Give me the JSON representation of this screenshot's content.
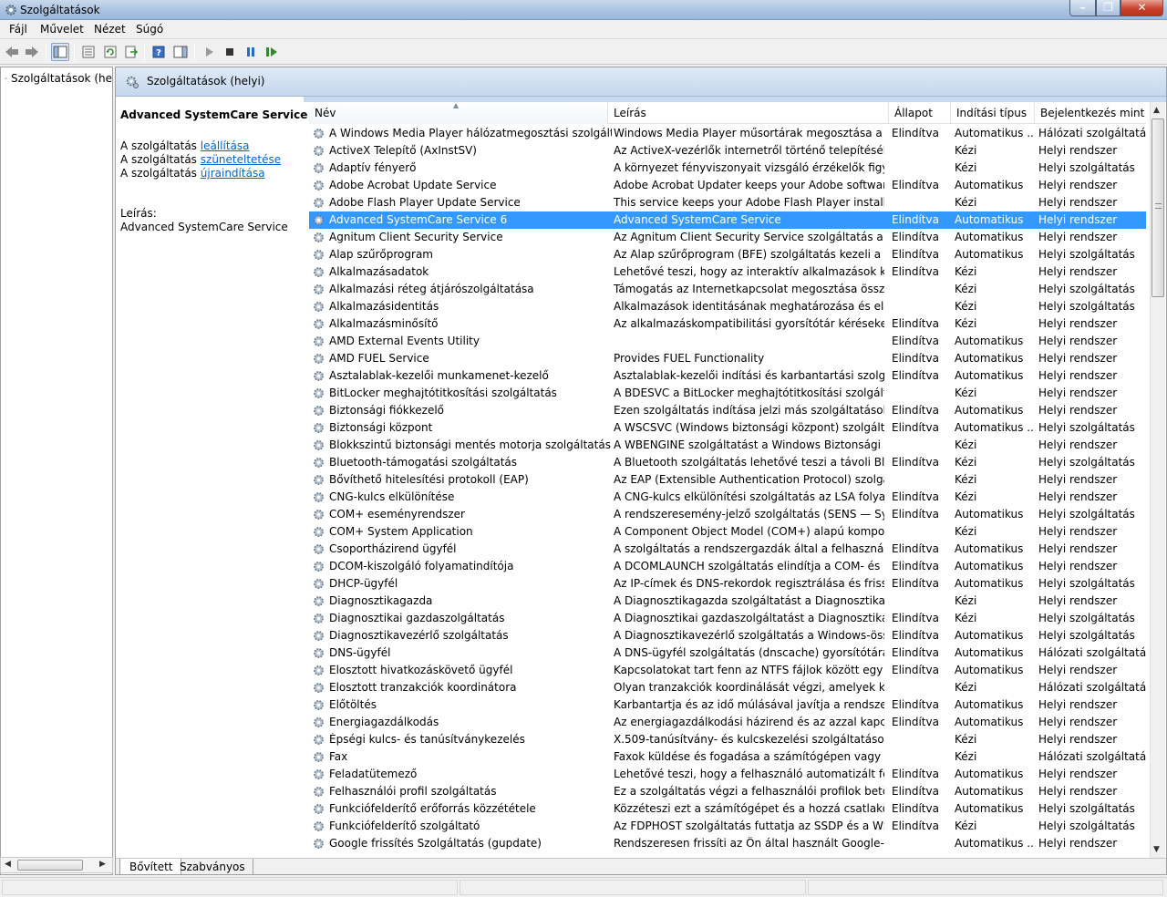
{
  "window": {
    "title": "Szolgáltatások"
  },
  "menu": [
    "Fájl",
    "Művelet",
    "Nézet",
    "Súgó"
  ],
  "toolbar": {
    "icons": [
      "back-icon",
      "forward-icon",
      "show-hide-tree-icon",
      "properties-icon",
      "refresh-icon",
      "export-list-icon",
      "help-icon",
      "action-pane-icon",
      "start-service-icon",
      "stop-service-icon",
      "pause-service-icon",
      "restart-service-icon"
    ]
  },
  "tree": {
    "root_label": "Szolgáltatások (he"
  },
  "panel": {
    "title": "Szolgáltatások (helyi)",
    "selected_service": "Advanced SystemCare Service 6",
    "action_prefix": "A szolgáltatás",
    "actions": [
      "leállítása",
      "szüneteltetése",
      "újraindítása"
    ],
    "description_label": "Leírás:",
    "description_text": "Advanced SystemCare Service"
  },
  "columns": [
    "Név",
    "Leírás",
    "Állapot",
    "Indítási típus",
    "Bejelentkezés mint"
  ],
  "selected_index": 5,
  "services": [
    {
      "name": "A Windows Media Player hálózatmegosztási szolgáltatása",
      "desc": "Windows Media Player műsortárak megosztása a háló...",
      "status": "Elindítva",
      "start": "Automatikus ...",
      "logon": "Hálózati szolgáltatás"
    },
    {
      "name": "ActiveX Telepítő (AxInstSV)",
      "desc": "Az ActiveX-vezérlők internetről történő telepítéséhez ...",
      "status": "",
      "start": "Kézi",
      "logon": "Helyi rendszer"
    },
    {
      "name": "Adaptív fényerő",
      "desc": "A környezet fényviszonyait vizsgáló érzékelők figyelés...",
      "status": "",
      "start": "Kézi",
      "logon": "Helyi szolgáltatás"
    },
    {
      "name": "Adobe Acrobat Update Service",
      "desc": "Adobe Acrobat Updater keeps your Adobe software u...",
      "status": "Elindítva",
      "start": "Automatikus",
      "logon": "Helyi rendszer"
    },
    {
      "name": "Adobe Flash Player Update Service",
      "desc": "This service keeps your Adobe Flash Player installatio...",
      "status": "",
      "start": "Kézi",
      "logon": "Helyi rendszer"
    },
    {
      "name": "Advanced SystemCare Service 6",
      "desc": "Advanced SystemCare Service",
      "status": "Elindítva",
      "start": "Automatikus",
      "logon": "Helyi rendszer"
    },
    {
      "name": "Agnitum Client Security Service",
      "desc": "Az Agnitum Client Security Service szolgáltatás a sze...",
      "status": "Elindítva",
      "start": "Automatikus",
      "logon": "Helyi rendszer"
    },
    {
      "name": "Alap szűrőprogram",
      "desc": "Az Alap szűrőprogram (BFE) szolgáltatás kezeli a tűzfal...",
      "status": "Elindítva",
      "start": "Automatikus",
      "logon": "Helyi szolgáltatás"
    },
    {
      "name": "Alkalmazásadatok",
      "desc": "Lehetővé teszi, hogy az interaktív alkalmazások kibővi...",
      "status": "Elindítva",
      "start": "Kézi",
      "logon": "Helyi rendszer"
    },
    {
      "name": "Alkalmazási réteg átjárószolgáltatása",
      "desc": "Támogatás az Internetkapcsolat megosztása összetev...",
      "status": "",
      "start": "Kézi",
      "logon": "Helyi szolgáltatás"
    },
    {
      "name": "Alkalmazásidentitás",
      "desc": "Alkalmazások identitásának meghatározása és ellenőr...",
      "status": "",
      "start": "Kézi",
      "logon": "Helyi szolgáltatás"
    },
    {
      "name": "Alkalmazásminősítő",
      "desc": "Az alkalmazáskompatibilitási gyorsítótár kéréseket dol...",
      "status": "Elindítva",
      "start": "Kézi",
      "logon": "Helyi rendszer"
    },
    {
      "name": "AMD External Events Utility",
      "desc": "",
      "status": "Elindítva",
      "start": "Automatikus",
      "logon": "Helyi rendszer"
    },
    {
      "name": "AMD FUEL Service",
      "desc": "Provides FUEL Functionality",
      "status": "Elindítva",
      "start": "Automatikus",
      "logon": "Helyi rendszer"
    },
    {
      "name": "Asztalablak-kezelői munkamenet-kezelő",
      "desc": "Asztalablak-kezelői indítási és karbantartási szolgáltat...",
      "status": "Elindítva",
      "start": "Automatikus",
      "logon": "Helyi rendszer"
    },
    {
      "name": "BitLocker meghajtótitkosítási szolgáltatás",
      "desc": "A BDESVC a BitLocker meghajtótitkosítási szolgáltatás...",
      "status": "",
      "start": "Kézi",
      "logon": "Helyi rendszer"
    },
    {
      "name": "Biztonsági fiókkezelő",
      "desc": "Ezen szolgáltatás indítása jelzi más szolgáltatásoknak, ...",
      "status": "Elindítva",
      "start": "Automatikus",
      "logon": "Helyi rendszer"
    },
    {
      "name": "Biztonsági központ",
      "desc": "A WSCSVC (Windows biztonsági központ) szolgáltatás...",
      "status": "Elindítva",
      "start": "Automatikus ...",
      "logon": "Helyi szolgáltatás"
    },
    {
      "name": "Blokkszintű biztonsági mentés motorja szolgáltatás",
      "desc": "A WBENGINE szolgáltatást a Windows Biztonsági más...",
      "status": "",
      "start": "Kézi",
      "logon": "Helyi rendszer"
    },
    {
      "name": "Bluetooth-támogatási szolgáltatás",
      "desc": "A Bluetooth szolgáltatás lehetővé teszi a távoli Blueto...",
      "status": "Elindítva",
      "start": "Kézi",
      "logon": "Helyi szolgáltatás"
    },
    {
      "name": "Bővíthető hitelesítési protokoll (EAP)",
      "desc": "Az EAP (Extensible Authentication Protocol) szolgáltat...",
      "status": "",
      "start": "Kézi",
      "logon": "Helyi rendszer"
    },
    {
      "name": "CNG-kulcs elkülönítése",
      "desc": "A CNG-kulcs elkülönítési szolgáltatás az LSA folyamat...",
      "status": "Elindítva",
      "start": "Kézi",
      "logon": "Helyi rendszer"
    },
    {
      "name": "COM+ eseményrendszer",
      "desc": "A rendszeresemény-jelző szolgáltatás (SENS — Syste...",
      "status": "Elindítva",
      "start": "Automatikus",
      "logon": "Helyi szolgáltatás"
    },
    {
      "name": "COM+ System Application",
      "desc": "A Component Object Model (COM+) alapú kompone...",
      "status": "",
      "start": "Kézi",
      "logon": "Helyi rendszer"
    },
    {
      "name": "Csoportházirend ügyfél",
      "desc": "A szolgáltatás a rendszergazdák által a felhasználók és ...",
      "status": "Elindítva",
      "start": "Automatikus",
      "logon": "Helyi rendszer"
    },
    {
      "name": "DCOM-kiszolgáló folyamatindítója",
      "desc": "A DCOMLAUNCH szolgáltatás elindítja a COM- és DC...",
      "status": "Elindítva",
      "start": "Automatikus",
      "logon": "Helyi rendszer"
    },
    {
      "name": "DHCP-ügyfél",
      "desc": "Az IP-címek és DNS-rekordok regisztrálása és frissítése...",
      "status": "Elindítva",
      "start": "Automatikus",
      "logon": "Helyi szolgáltatás"
    },
    {
      "name": "Diagnosztikagazda",
      "desc": "A Diagnosztikagazda szolgáltatást a Diagnosztikavezér...",
      "status": "",
      "start": "Kézi",
      "logon": "Helyi rendszer"
    },
    {
      "name": "Diagnosztikai gazdaszolgáltatás",
      "desc": "A Diagnosztikai gazdaszolgáltatást a Diagnosztikavezé...",
      "status": "Elindítva",
      "start": "Kézi",
      "logon": "Helyi szolgáltatás"
    },
    {
      "name": "Diagnosztikavezérlő szolgáltatás",
      "desc": "A Diagnosztikavezérlő szolgáltatás a Windows-összete...",
      "status": "Elindítva",
      "start": "Automatikus",
      "logon": "Helyi szolgáltatás"
    },
    {
      "name": "DNS-ügyfél",
      "desc": "A DNS-ügyfél szolgáltatás (dnscache) gyorsítótárazza ...",
      "status": "Elindítva",
      "start": "Automatikus",
      "logon": "Hálózati szolgáltatás"
    },
    {
      "name": "Elosztott hivatkozáskövető ügyfél",
      "desc": "Kapcsolatokat tart fenn az NTFS fájlok között egy szá...",
      "status": "Elindítva",
      "start": "Automatikus",
      "logon": "Helyi rendszer"
    },
    {
      "name": "Elosztott tranzakciók koordinátora",
      "desc": "Olyan tranzakciók koordinálását végzi, amelyek két va...",
      "status": "",
      "start": "Kézi",
      "logon": "Hálózati szolgáltatás"
    },
    {
      "name": "Előtöltés",
      "desc": "Karbantartja és az idő múlásával javítja a rendszer telje...",
      "status": "Elindítva",
      "start": "Automatikus",
      "logon": "Helyi rendszer"
    },
    {
      "name": "Energiagazdálkodás",
      "desc": "Az energiagazdálkodási házirend és az azzal kapcsolat...",
      "status": "Elindítva",
      "start": "Automatikus",
      "logon": "Helyi rendszer"
    },
    {
      "name": "Épségi kulcs- és tanúsítványkezelés",
      "desc": "X.509-tanúsítvány- és kulcskezelési szolgáltatásokat n...",
      "status": "",
      "start": "Kézi",
      "logon": "Helyi rendszer"
    },
    {
      "name": "Fax",
      "desc": "Faxok küldése és fogadása a számítógépen vagy a hál...",
      "status": "",
      "start": "Kézi",
      "logon": "Hálózati szolgáltatás"
    },
    {
      "name": "Feladatütemező",
      "desc": "Lehetővé teszi, hogy a felhasználó automatizált felada...",
      "status": "Elindítva",
      "start": "Automatikus",
      "logon": "Helyi rendszer"
    },
    {
      "name": "Felhasználói profil szolgáltatás",
      "desc": "Ez a szolgáltatás végzi a felhasználói profilok betöltésé...",
      "status": "Elindítva",
      "start": "Automatikus",
      "logon": "Helyi rendszer"
    },
    {
      "name": "Funkciófelderítő erőforrás közzététele",
      "desc": "Közzéteszi ezt a számítógépet és a hozzá csatlakozó er...",
      "status": "Elindítva",
      "start": "Automatikus",
      "logon": "Helyi szolgáltatás"
    },
    {
      "name": "Funkciófelderítő szolgáltató",
      "desc": "Az FDPHOST szolgáltatás futtatja az SSDP és a WS-D p...",
      "status": "Elindítva",
      "start": "Kézi",
      "logon": "Helyi szolgáltatás"
    },
    {
      "name": "Google frissítés Szolgáltatás (gupdate)",
      "desc": "Rendszeresen frissíti az Ön által használt Google-szoft...",
      "status": "",
      "start": "Automatikus ...",
      "logon": "Helyi rendszer"
    }
  ],
  "tabs": [
    "Bővített",
    "Szabványos"
  ],
  "colors": {
    "selection": "#3399ff",
    "link": "#0066cc"
  }
}
